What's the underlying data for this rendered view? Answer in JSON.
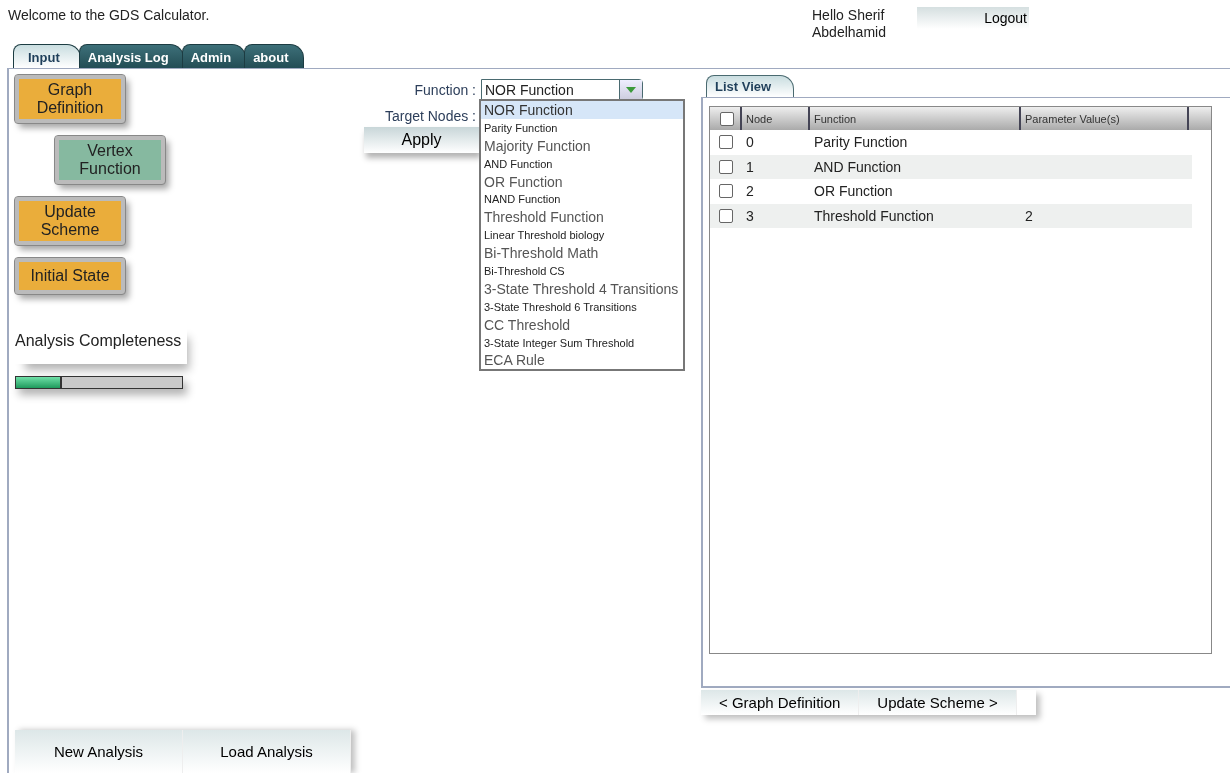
{
  "header": {
    "welcome": "Welcome to the GDS Calculator.",
    "greeting": "Hello Sherif Abdelhamid",
    "logout": "Logout"
  },
  "tabs": [
    {
      "label": "Input",
      "selected": true
    },
    {
      "label": "Analysis Log",
      "selected": false
    },
    {
      "label": "Admin",
      "selected": false
    },
    {
      "label": "about",
      "selected": false
    }
  ],
  "steps": [
    {
      "label": "Graph Definition",
      "selected": false
    },
    {
      "label": "Vertex Function",
      "selected": true
    },
    {
      "label": "Update Scheme",
      "selected": false
    },
    {
      "label": "Initial State",
      "selected": false
    }
  ],
  "completeness": {
    "label": "Analysis Completeness",
    "level": 0.28
  },
  "bottom_buttons": [
    "New Analysis",
    "Load Analysis"
  ],
  "form": {
    "function_label": "Function :",
    "function_value": "NOR Function",
    "target_label": "Target Nodes :",
    "apply": "Apply"
  },
  "dropdown": [
    {
      "label": "NOR Function",
      "kind": "large",
      "selected": true
    },
    {
      "label": "Parity Function",
      "kind": "small",
      "selected": false
    },
    {
      "label": "Majority Function",
      "kind": "large",
      "selected": false
    },
    {
      "label": "AND Function",
      "kind": "small",
      "selected": false
    },
    {
      "label": "OR Function",
      "kind": "large",
      "selected": false
    },
    {
      "label": "NAND Function",
      "kind": "small",
      "selected": false
    },
    {
      "label": "Threshold Function",
      "kind": "large",
      "selected": false
    },
    {
      "label": "Linear Threshold biology",
      "kind": "small",
      "selected": false
    },
    {
      "label": "Bi-Threshold Math",
      "kind": "large",
      "selected": false
    },
    {
      "label": "Bi-Threshold CS",
      "kind": "small",
      "selected": false
    },
    {
      "label": "3-State Threshold 4 Transitions",
      "kind": "large",
      "selected": false
    },
    {
      "label": "3-State Threshold 6 Transitions",
      "kind": "small",
      "selected": false
    },
    {
      "label": "CC Threshold",
      "kind": "large",
      "selected": false
    },
    {
      "label": "3-State Integer Sum Threshold",
      "kind": "small",
      "selected": false
    },
    {
      "label": "ECA Rule",
      "kind": "large",
      "selected": false
    }
  ],
  "list_view": {
    "tab": "List View",
    "all_checked": false,
    "columns": [
      "Node",
      "Function",
      "Parameter Value(s)"
    ],
    "rows": [
      {
        "node": "0",
        "function": "Parity Function",
        "params": "",
        "checked": false
      },
      {
        "node": "1",
        "function": "AND Function",
        "params": "",
        "checked": false
      },
      {
        "node": "2",
        "function": "OR Function",
        "params": "",
        "checked": false
      },
      {
        "node": "3",
        "function": "Threshold Function",
        "params": "2",
        "checked": false
      }
    ]
  },
  "nav_buttons": [
    "< Graph Definition",
    "Update Scheme >"
  ]
}
